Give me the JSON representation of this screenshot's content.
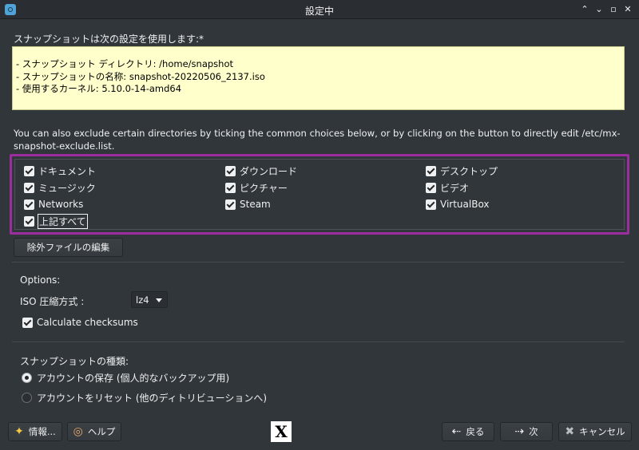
{
  "window": {
    "title": "設定中",
    "controls": [
      "⌃",
      "⌄",
      "▫",
      "✕"
    ]
  },
  "header": {
    "label": "スナップショットは次の設定を使用します:*"
  },
  "info": {
    "lines": [
      "- スナップショット ディレクトリ:  /home/snapshot",
      "- スナップショットの名称: snapshot-20220506_2137.iso",
      "- 使用するカーネル:  5.10.0-14-amd64"
    ]
  },
  "exclude_description": "You can also exclude certain directories by ticking the common choices below, or by clicking on the button to directly edit /etc/mx-snapshot-exclude.list.",
  "exclude_options": [
    {
      "label": "ドキュメント",
      "checked": true
    },
    {
      "label": "ダウンロード",
      "checked": true
    },
    {
      "label": "デスクトップ",
      "checked": true
    },
    {
      "label": "ミュージック",
      "checked": true
    },
    {
      "label": "ピクチャー",
      "checked": true
    },
    {
      "label": "ビデオ",
      "checked": true
    },
    {
      "label": "Networks",
      "checked": true
    },
    {
      "label": "Steam",
      "checked": true
    },
    {
      "label": "VirtualBox",
      "checked": true
    },
    {
      "label": "上記すべて",
      "checked": true
    }
  ],
  "edit_exclusion_button": "除外ファイルの編集",
  "options": {
    "heading": "Options:",
    "compression_label": "ISO 圧縮方式 :",
    "compression_value": "lz4",
    "checksums_label": "Calculate checksums",
    "checksums_checked": true
  },
  "snapshot_type": {
    "heading": "スナップショットの種類:",
    "choices": [
      {
        "label": "アカウントの保存 (個人的なバックアップ用)",
        "selected": true
      },
      {
        "label": "アカウントをリセット (他のディトリビューションへ)",
        "selected": false
      }
    ]
  },
  "footer": {
    "about_label": "情報...",
    "help_label": "ヘルプ",
    "logo_text": "X",
    "back_label": "戻る",
    "next_label": "次",
    "cancel_label": "キャンセル"
  },
  "colors": {
    "background": "#31363b",
    "info_background": "#ffffcc",
    "highlight_border": "#9b2d9e"
  },
  "icons": {
    "about": "star-icon",
    "help": "lifebuoy-icon",
    "back": "arrow-left-icon",
    "next": "arrow-right-icon",
    "cancel": "x-icon"
  }
}
